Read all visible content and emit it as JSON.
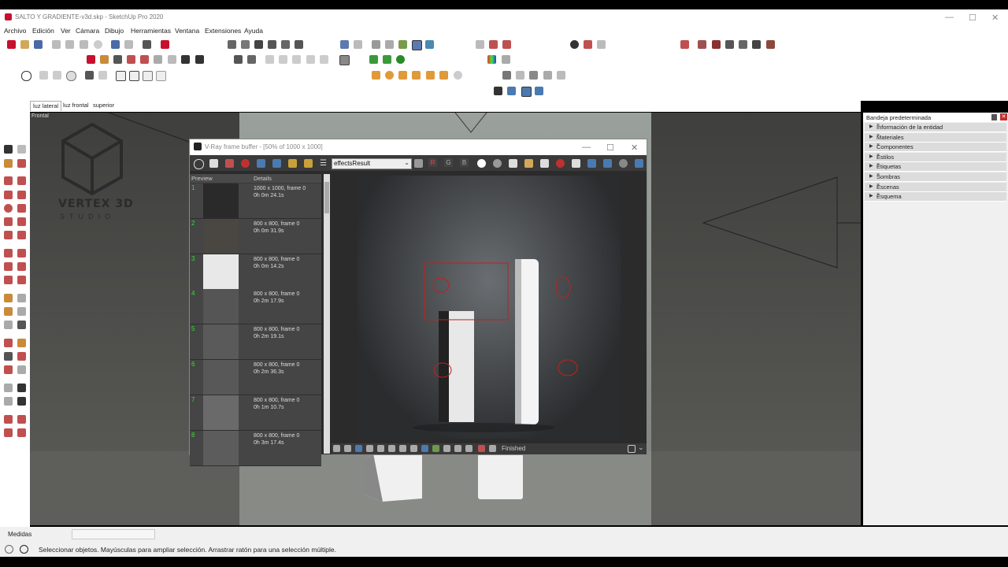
{
  "app": {
    "window_title": "SALTO Y GRADIENTE-v3d.skp - SketchUp Pro 2020",
    "menu": [
      "Archivo",
      "Edición",
      "Ver",
      "Cámara",
      "Dibujo",
      "Herramientas",
      "Ventana",
      "Extensiones",
      "Ayuda"
    ],
    "scene_tabs": [
      "luz lateral",
      "luz frontal",
      "superior"
    ],
    "active_scene": "luz lateral",
    "viewport_label": "Frontal",
    "logo_text": "VERTEX 3D",
    "logo_sub": "STUDIO"
  },
  "vray": {
    "title": "V-Ray frame buffer - [50% of 1000 x 1000]",
    "channel": "effectsResult",
    "channel_buttons": [
      "R",
      "G",
      "B"
    ],
    "history_headers": [
      "Preview",
      "Details"
    ],
    "history": [
      {
        "num": "1",
        "size": "1000 x 1000, frame 0",
        "time": "0h 0m 24.1s",
        "shade": "#2a2a2a"
      },
      {
        "num": "2",
        "size": "800 x 800, frame 0",
        "time": "0h 0m 31.9s",
        "shade": "#4a4642"
      },
      {
        "num": "3",
        "size": "800 x 800, frame 0",
        "time": "0h 0m 14.2s",
        "shade": "#e8e8e8"
      },
      {
        "num": "4",
        "size": "800 x 800, frame 0",
        "time": "0h 2m 17.9s",
        "shade": "#555555"
      },
      {
        "num": "5",
        "size": "800 x 800, frame 0",
        "time": "0h 2m 19.1s",
        "shade": "#5a5a5a"
      },
      {
        "num": "6",
        "size": "800 x 800, frame 0",
        "time": "0h 2m 36.3s",
        "shade": "#585858"
      },
      {
        "num": "7",
        "size": "800 x 800, frame 0",
        "time": "0h 1m 10.7s",
        "shade": "#6a6a6a"
      },
      {
        "num": "8",
        "size": "800 x 800, frame 0",
        "time": "0h 3m 17.4s",
        "shade": "#5c5c5c"
      }
    ],
    "status": "Finished"
  },
  "tray": {
    "title": "Bandeja predeterminada",
    "items": [
      "Información de la entidad",
      "Materiales",
      "Componentes",
      "Estilos",
      "Etiquetas",
      "Sombras",
      "Escenas",
      "Esquema"
    ]
  },
  "measurements_label": "Medidas",
  "status_text": "Seleccionar objetos. Mayúsculas para ampliar selección. Arrastrar ratón para una selección múltiple."
}
